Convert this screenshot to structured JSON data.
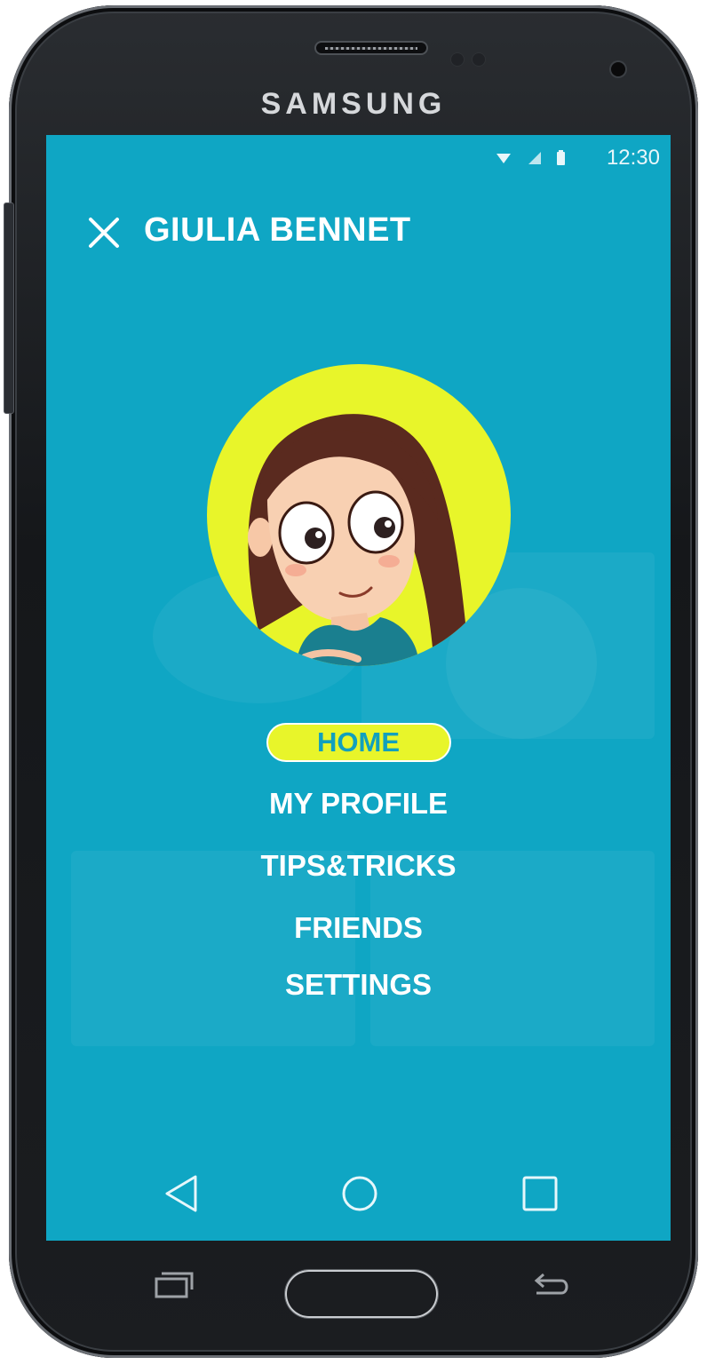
{
  "device": {
    "brand": "SAMSUNG"
  },
  "status_bar": {
    "time": "12:30",
    "icons": [
      "wifi-icon",
      "signal-icon",
      "battery-icon"
    ]
  },
  "header": {
    "title": "GIULIA BENNET",
    "close_icon": "close-icon"
  },
  "avatar": {
    "icon": "girl-avatar-illustration"
  },
  "menu": {
    "items": [
      {
        "label": "HOME",
        "active": true
      },
      {
        "label": "MY PROFILE",
        "active": false
      },
      {
        "label": "TIPS&TRICKS",
        "active": false
      },
      {
        "label": "FRIENDS",
        "active": false
      },
      {
        "label": "SETTINGS",
        "active": false
      }
    ]
  },
  "nav_bar": {
    "icons": [
      "back-triangle-icon",
      "home-circle-icon",
      "recents-square-icon"
    ]
  },
  "colors": {
    "accent": "#0fa6c4",
    "highlight": "#e8f52a",
    "text": "#ffffff"
  }
}
